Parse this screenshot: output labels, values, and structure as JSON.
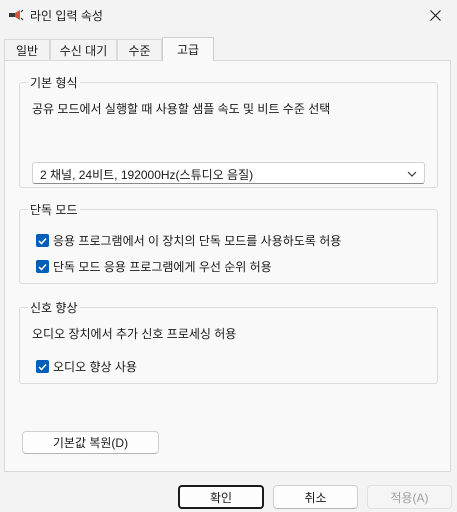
{
  "window": {
    "title": "라인 입력 속성"
  },
  "tabs": [
    {
      "label": "일반"
    },
    {
      "label": "수신 대기"
    },
    {
      "label": "수준"
    },
    {
      "label": "고급"
    }
  ],
  "default_format": {
    "title": "기본 형식",
    "description": "공유 모드에서 실행할 때 사용할 샘플 속도 및 비트 수준 선택",
    "selected": "2 채널, 24비트, 192000Hz(스튜디오 음질)"
  },
  "exclusive_mode": {
    "title": "단독 모드",
    "options": [
      {
        "label": "응용 프로그램에서 이 장치의 단독 모드를 사용하도록 허용",
        "checked": true
      },
      {
        "label": "단독 모드 응용 프로그램에게 우선 순위 허용",
        "checked": true
      }
    ]
  },
  "signal_enhancement": {
    "title": "신호 향상",
    "description": "오디오 장치에서 추가 신호 프로세싱 허용",
    "option": {
      "label": "오디오 향상 사용",
      "checked": true
    }
  },
  "buttons": {
    "restore_defaults": "기본값 복원(D)",
    "ok": "확인",
    "cancel": "취소",
    "apply": "적용(A)"
  },
  "colors": {
    "accent": "#005fb8",
    "window_bg": "#f3f3f3",
    "panel_bg": "#f9f9f9"
  },
  "icons": {
    "app": "speaker-icon",
    "close": "close-icon",
    "dropdown": "chevron-down-icon",
    "checkbox": "checkmark-icon"
  }
}
